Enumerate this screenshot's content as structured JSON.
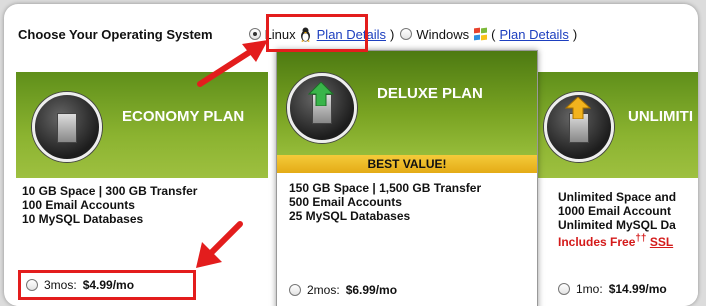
{
  "os_selector": {
    "title": "Choose Your Operating System",
    "linux": {
      "label": "Linux",
      "selected": true
    },
    "linux_link_open": "(",
    "plan_details_link": "Plan Details",
    "linux_link_close": ")",
    "windows": {
      "label": "Windows",
      "selected": false
    },
    "windows_link_open": "(",
    "windows_link_close": ")"
  },
  "plans": {
    "economy": {
      "name": "ECONOMY PLAN",
      "specs": [
        "10 GB Space | 300 GB Transfer",
        "100 Email Accounts",
        "10 MySQL Databases"
      ],
      "price_term": "3mos:",
      "price": "$4.99/mo"
    },
    "deluxe": {
      "name": "DELUXE PLAN",
      "badge": "BEST VALUE!",
      "specs": [
        "150 GB Space | 1,500 GB Transfer",
        "500 Email Accounts",
        "25 MySQL Databases"
      ],
      "price_term": "2mos:",
      "price": "$6.99/mo"
    },
    "unlimited": {
      "name": "UNLIMITI",
      "specs": [
        "Unlimited Space and",
        "1000 Email Account",
        "Unlimited MySQL Da"
      ],
      "extra_prefix": "Includes Free",
      "extra_sup": "††",
      "extra_link": "SSL",
      "price_term": "1mo:",
      "price": "$14.99/mo"
    }
  },
  "colors": {
    "highlight": "#e31d1d",
    "link": "#1d3fbf",
    "plan_green": "#8bb330",
    "badge_gold": "#f0c030"
  },
  "icons": [
    "tux-icon",
    "windows-flag-icon",
    "server-icon",
    "upgrade-arrow-icon",
    "radio-button"
  ]
}
